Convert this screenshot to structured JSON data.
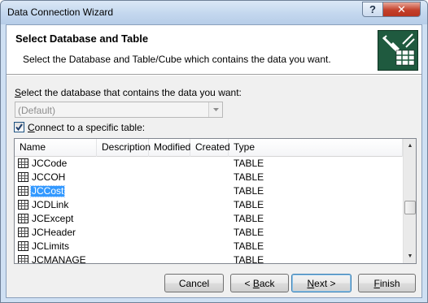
{
  "window": {
    "title": "Data Connection Wizard",
    "help_label": "?",
    "close_label": "✕"
  },
  "header": {
    "title": "Select Database and Table",
    "description": "Select the Database and Table/Cube which contains the data you want.",
    "icon": "database-plug-icon"
  },
  "database": {
    "label_key": "S",
    "label_rest": "elect the database that contains the data you want:",
    "value": "(Default)"
  },
  "connect_table": {
    "checked": true,
    "label_key": "C",
    "label_rest": "onnect to a specific table:"
  },
  "table_list": {
    "columns": [
      "Name",
      "Description",
      "Modified",
      "Created",
      "Type"
    ],
    "rows": [
      {
        "name": "JCCode",
        "type": "TABLE",
        "selected": false
      },
      {
        "name": "JCCOH",
        "type": "TABLE",
        "selected": false
      },
      {
        "name": "JCCost",
        "type": "TABLE",
        "selected": true
      },
      {
        "name": "JCDLink",
        "type": "TABLE",
        "selected": false
      },
      {
        "name": "JCExcept",
        "type": "TABLE",
        "selected": false
      },
      {
        "name": "JCHeader",
        "type": "TABLE",
        "selected": false
      },
      {
        "name": "JCLimits",
        "type": "TABLE",
        "selected": false
      },
      {
        "name": "JCMANAGE",
        "type": "TABLE",
        "selected": false
      }
    ]
  },
  "buttons": {
    "cancel": "Cancel",
    "back_prefix": "< ",
    "back_key": "B",
    "back_rest": "ack",
    "next_key": "N",
    "next_rest": "ext >",
    "finish_key": "F",
    "finish_rest": "inish"
  }
}
